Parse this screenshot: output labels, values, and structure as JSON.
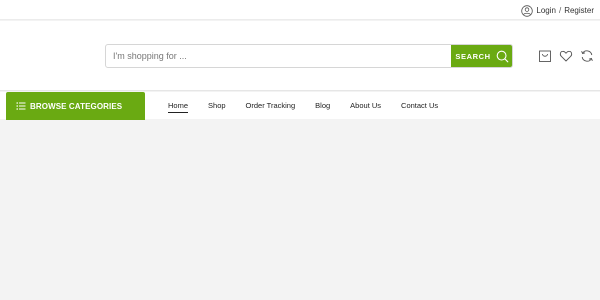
{
  "topbar": {
    "login_label": "Login",
    "separator": "/",
    "register_label": "Register"
  },
  "search": {
    "placeholder": "I'm shopping for ...",
    "value": "",
    "button_label": "SEARCH"
  },
  "header_icons": [
    "cart-icon",
    "heart-icon",
    "compare-icon"
  ],
  "nav": {
    "browse_label": "BROWSE CATEGORIES",
    "items": [
      {
        "label": "Home",
        "active": true
      },
      {
        "label": "Shop"
      },
      {
        "label": "Order Tracking"
      },
      {
        "label": "Blog"
      },
      {
        "label": "About Us"
      },
      {
        "label": "Contact Us"
      }
    ]
  },
  "colors": {
    "accent": "#6aaa12",
    "page_bg": "#f3f3f3",
    "header_bg": "#ffffff"
  }
}
